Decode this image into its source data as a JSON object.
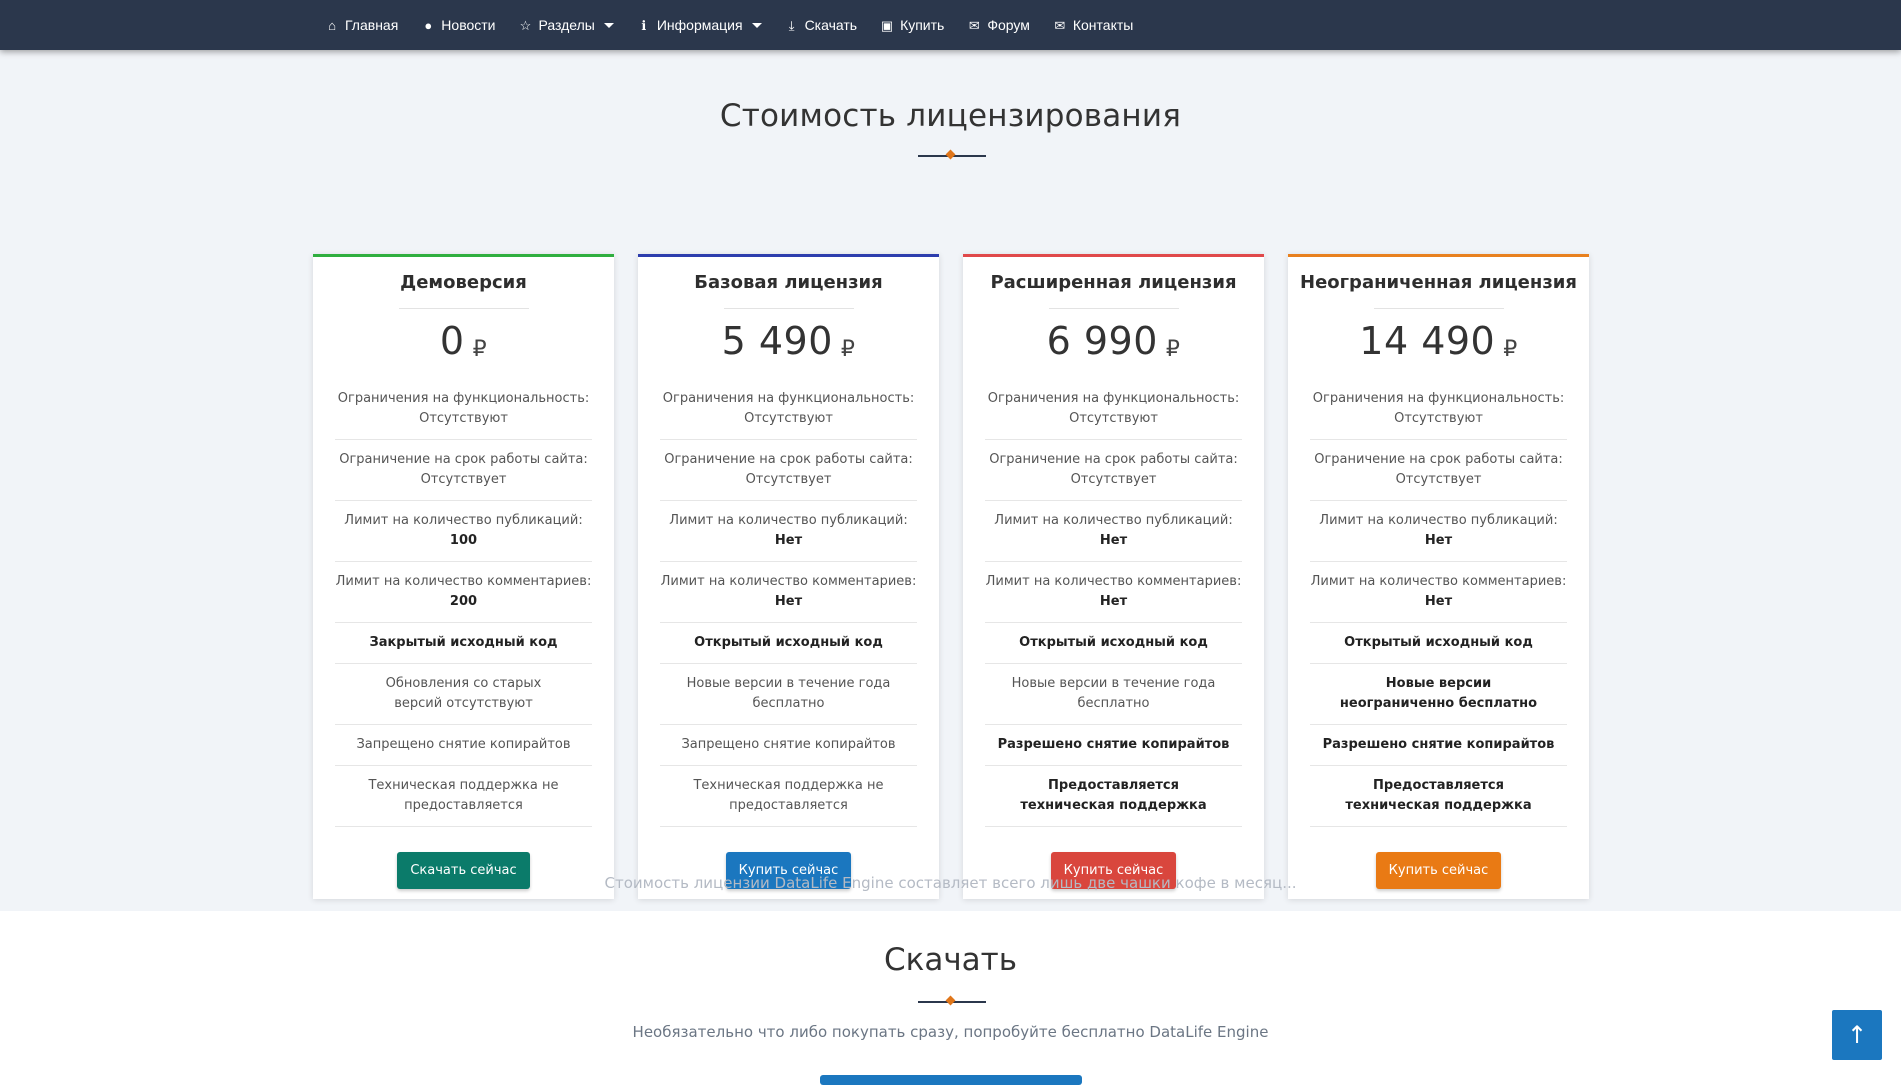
{
  "nav": {
    "items": [
      {
        "icon": "home-icon",
        "glyph": "⌂",
        "label": "Главная",
        "has_caret": false
      },
      {
        "icon": "globe-icon",
        "glyph": "●",
        "label": "Новости",
        "has_caret": false
      },
      {
        "icon": "star-icon",
        "glyph": "☆",
        "label": "Разделы",
        "has_caret": true
      },
      {
        "icon": "info-icon",
        "glyph": "ℹ",
        "label": "Информация",
        "has_caret": true
      },
      {
        "icon": "download-icon",
        "glyph": "⤓",
        "label": "Скачать",
        "has_caret": false
      },
      {
        "icon": "money-icon",
        "glyph": "▣",
        "label": "Купить",
        "has_caret": false
      },
      {
        "icon": "comments-icon",
        "glyph": "✉",
        "label": "Форум",
        "has_caret": false
      },
      {
        "icon": "envelope-icon",
        "glyph": "✉",
        "label": "Контакты",
        "has_caret": false
      }
    ]
  },
  "pricing": {
    "title": "Стоимость лицензирования",
    "tagline": "Стоимость лицензии DataLife Engine составляет всего лишь две чашки кофе в месяц...",
    "currency": "₽",
    "cards": [
      {
        "title": "Демоверсия",
        "price": "0",
        "accent": "#2fae3f",
        "button_label": "Скачать сейчас",
        "button_style": "green",
        "features": {
          "func_limit_label": "Ограничения на функциональность:",
          "func_limit_value": "Отсутствуют",
          "term_label": "Ограничение на срок работы сайта:",
          "term_value": "Отсутствует",
          "pub_label": "Лимит на количество публикаций:",
          "pub_value": "100",
          "comm_label": "Лимит на количество комментариев:",
          "comm_value": "200",
          "source": "Закрытый исходный код",
          "updates": "Обновления со старых версий отсутствуют",
          "copyright": "Запрещено снятие копирайтов",
          "support": "Техническая поддержка не предоставляется"
        }
      },
      {
        "title": "Базовая лицензия",
        "price": "5 490",
        "accent": "#2d3dad",
        "button_label": "Купить сейчас",
        "button_style": "blue",
        "features": {
          "func_limit_label": "Ограничения на функциональность:",
          "func_limit_value": "Отсутствуют",
          "term_label": "Ограничение на срок работы сайта:",
          "term_value": "Отсутствует",
          "pub_label": "Лимит на количество публикаций:",
          "pub_value": "Нет",
          "comm_label": "Лимит на количество комментариев:",
          "comm_value": "Нет",
          "source": "Открытый исходный код",
          "updates": "Новые версии в течение года бесплатно",
          "copyright": "Запрещено снятие копирайтов",
          "support": "Техническая поддержка не предоставляется"
        }
      },
      {
        "title": "Расширенная лицензия",
        "price": "6 990",
        "accent": "#e0484a",
        "button_label": "Купить сейчас",
        "button_style": "red",
        "features": {
          "func_limit_label": "Ограничения на функциональность:",
          "func_limit_value": "Отсутствуют",
          "term_label": "Ограничение на срок работы сайта:",
          "term_value": "Отсутствует",
          "pub_label": "Лимит на количество публикаций:",
          "pub_value": "Нет",
          "comm_label": "Лимит на количество комментариев:",
          "comm_value": "Нет",
          "source": "Открытый исходный код",
          "updates": "Новые версии в течение года бесплатно",
          "copyright": "Разрешено снятие копирайтов",
          "support": "Предоставляется техническая поддержка"
        }
      },
      {
        "title": "Неограниченная лицензия",
        "price": "14 490",
        "accent": "#e8801e",
        "button_label": "Купить сейчас",
        "button_style": "orange",
        "features": {
          "func_limit_label": "Ограничения на функциональность:",
          "func_limit_value": "Отсутствуют",
          "term_label": "Ограничение на срок работы сайта:",
          "term_value": "Отсутствует",
          "pub_label": "Лимит на количество публикаций:",
          "pub_value": "Нет",
          "comm_label": "Лимит на количество комментариев:",
          "comm_value": "Нет",
          "source": "Открытый исходный код",
          "updates": "Новые версии неограниченно бесплатно",
          "copyright": "Разрешено снятие копирайтов",
          "support": "Предоставляется техническая поддержка"
        }
      }
    ]
  },
  "download": {
    "title": "Скачать",
    "subtitle": "Необязательно что либо покупать сразу, попробуйте бесплатно DataLife Engine"
  },
  "scroll_top": {
    "glyph": "↑"
  }
}
